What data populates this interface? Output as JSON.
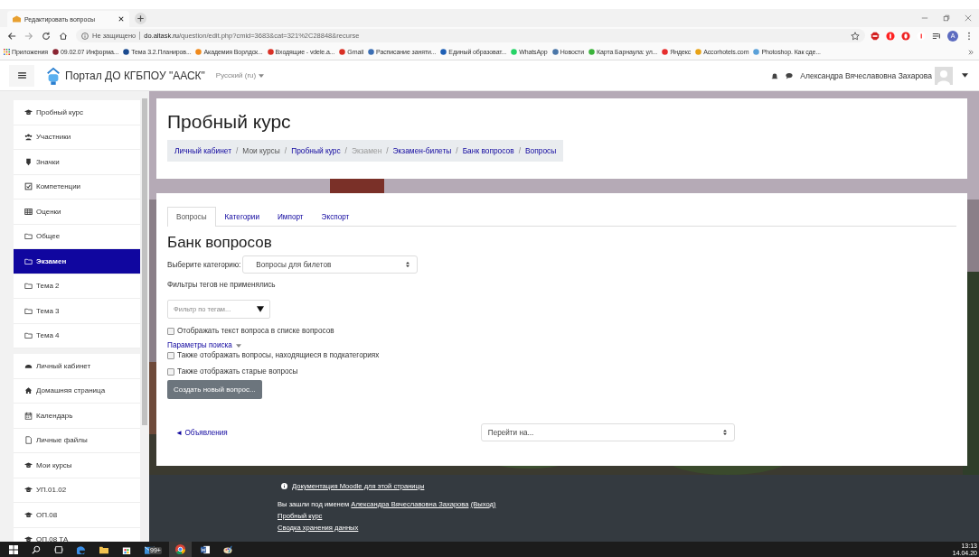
{
  "browser": {
    "tab": {
      "title": "Редактировать вопросы"
    },
    "address": {
      "security": "Не защищено",
      "domain": "do.altask.ru",
      "path": "/question/edit.php?cmid=3683&cat=321%2C28848&recurse"
    },
    "profile_initial": "A",
    "bookmarks": [
      "Приложения",
      "09.02.07 Информа...",
      "Тема 3.2.Планиров...",
      "Академия Ворлдск...",
      "Входящие - vdele.a...",
      "Gmail",
      "Расписание заняти...",
      "Единый образоват...",
      "WhatsApp",
      "Новости",
      "Карта Барнаула: ул...",
      "Яндекс",
      "Accorhotels.com",
      "Photoshop. Как сде..."
    ]
  },
  "navbar": {
    "site_name": "Портал ДО КГБПОУ \"ААСК\"",
    "language": "Русский (ru)",
    "user_name": "Александра Вячеславовна Захарова"
  },
  "sidebar": {
    "groups": [
      [
        {
          "label": "Пробный курс",
          "selected": false
        },
        {
          "label": "Участники",
          "selected": false
        },
        {
          "label": "Значки",
          "selected": false
        },
        {
          "label": "Компетенции",
          "selected": false
        },
        {
          "label": "Оценки",
          "selected": false
        },
        {
          "label": "Общее",
          "selected": false
        },
        {
          "label": "Экзамен",
          "selected": true
        },
        {
          "label": "Тема 2",
          "selected": false
        },
        {
          "label": "Тема 3",
          "selected": false
        },
        {
          "label": "Тема 4",
          "selected": false
        }
      ],
      [
        {
          "label": "Личный кабинет",
          "selected": false
        },
        {
          "label": "Домашняя страница",
          "selected": false
        },
        {
          "label": "Календарь",
          "selected": false
        },
        {
          "label": "Личные файлы",
          "selected": false
        },
        {
          "label": "Мои курсы",
          "selected": false
        },
        {
          "label": "УП.01.02",
          "selected": false
        },
        {
          "label": "ОП.08",
          "selected": false
        },
        {
          "label": "ОП.08 ТА",
          "selected": false
        }
      ]
    ]
  },
  "header": {
    "title": "Пробный курс",
    "breadcrumb_separator": "/",
    "breadcrumbs": [
      {
        "label": "Личный кабинет",
        "link": true
      },
      {
        "label": "Мои курсы",
        "link": false
      },
      {
        "label": "Пробный курс",
        "link": true
      },
      {
        "label": "Экзамен",
        "link": false
      },
      {
        "label": "Экзамен-билеты",
        "link": true
      },
      {
        "label": "Банк вопросов",
        "link": true
      },
      {
        "label": "Вопросы",
        "link": true
      }
    ]
  },
  "tabs": [
    {
      "label": "Вопросы",
      "selected": true
    },
    {
      "label": "Категории",
      "selected": false
    },
    {
      "label": "Импорт",
      "selected": false
    },
    {
      "label": "Экспорт",
      "selected": false
    }
  ],
  "bank": {
    "title": "Банк вопросов",
    "category_label": "Выберите категорию:",
    "category_value": "Вопросы для билетов",
    "tag_note": "Фильтры тегов не применялись",
    "tag_filter_placeholder": "Фильтр по тегам...",
    "show_text": {
      "label": "Отображать текст вопроса в списке вопросов",
      "checked": false
    },
    "search_options": "Параметры поиска",
    "options": [
      {
        "label": "Также отображать вопросы, находящиеся в подкатегориях",
        "checked": false
      },
      {
        "label": "Также отображать старые вопросы",
        "checked": false
      }
    ],
    "create_button": "Создать новый вопрос...",
    "prev_link": "◄ Объявления",
    "jump_placeholder": "Перейти на..."
  },
  "footer": {
    "docs_link": "Документация Moodle для этой страницы",
    "logged_in_prefix": "Вы зашли под именем",
    "logged_in_user": "Александра Вячеславовна Захарова",
    "logout": "(Выход)",
    "links": [
      "Пробный курс",
      "Сводка хранения данных"
    ]
  },
  "taskbar": {
    "mail_badge": "99+",
    "time": "13:13",
    "date": "14.04.20"
  }
}
